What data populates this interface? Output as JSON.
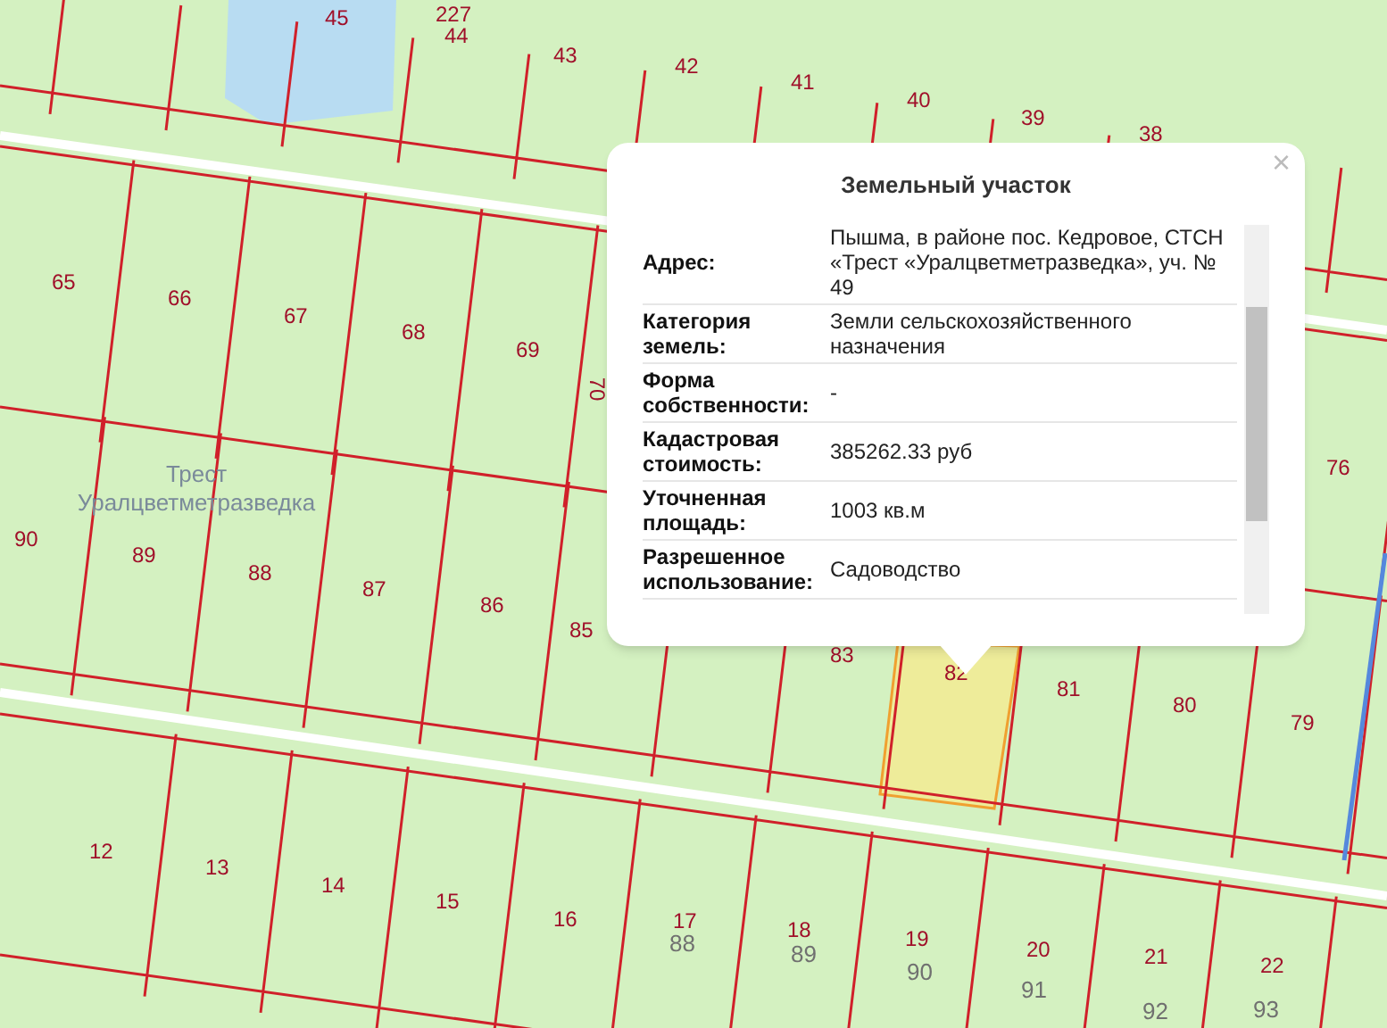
{
  "map": {
    "area_name": "Трест Уралцветметразведка",
    "labels": [
      {
        "text": "227",
        "kind": "parcel"
      },
      {
        "text": "45",
        "kind": "parcel"
      },
      {
        "text": "44",
        "kind": "parcel"
      },
      {
        "text": "43",
        "kind": "parcel"
      },
      {
        "text": "42",
        "kind": "parcel"
      },
      {
        "text": "41",
        "kind": "parcel"
      },
      {
        "text": "40",
        "kind": "parcel"
      },
      {
        "text": "39",
        "kind": "parcel"
      },
      {
        "text": "38",
        "kind": "parcel"
      },
      {
        "text": "65",
        "kind": "parcel"
      },
      {
        "text": "66",
        "kind": "parcel"
      },
      {
        "text": "67",
        "kind": "parcel"
      },
      {
        "text": "68",
        "kind": "parcel"
      },
      {
        "text": "69",
        "kind": "parcel"
      },
      {
        "text": "70",
        "kind": "vertical"
      },
      {
        "text": "76",
        "kind": "parcel"
      },
      {
        "text": "90",
        "kind": "parcel"
      },
      {
        "text": "89",
        "kind": "parcel"
      },
      {
        "text": "88",
        "kind": "parcel"
      },
      {
        "text": "87",
        "kind": "parcel"
      },
      {
        "text": "86",
        "kind": "parcel"
      },
      {
        "text": "85",
        "kind": "parcel"
      },
      {
        "text": "83",
        "kind": "parcel"
      },
      {
        "text": "82",
        "kind": "parcel"
      },
      {
        "text": "81",
        "kind": "parcel"
      },
      {
        "text": "80",
        "kind": "parcel"
      },
      {
        "text": "79",
        "kind": "parcel"
      },
      {
        "text": "12",
        "kind": "parcel"
      },
      {
        "text": "13",
        "kind": "parcel"
      },
      {
        "text": "14",
        "kind": "parcel"
      },
      {
        "text": "15",
        "kind": "parcel"
      },
      {
        "text": "16",
        "kind": "parcel"
      },
      {
        "text": "17",
        "kind": "parcel"
      },
      {
        "text": "88",
        "kind": "old"
      },
      {
        "text": "18",
        "kind": "parcel"
      },
      {
        "text": "89",
        "kind": "old"
      },
      {
        "text": "19",
        "kind": "parcel"
      },
      {
        "text": "90",
        "kind": "old"
      },
      {
        "text": "20",
        "kind": "parcel"
      },
      {
        "text": "91",
        "kind": "old"
      },
      {
        "text": "21",
        "kind": "parcel"
      },
      {
        "text": "92",
        "kind": "old"
      },
      {
        "text": "22",
        "kind": "parcel"
      },
      {
        "text": "93",
        "kind": "old"
      }
    ]
  },
  "popup": {
    "title": "Земельный участок",
    "close": "×",
    "rows": [
      {
        "label": "Адрес:",
        "value": "Пышма, в районе пос. Кедровое, СТСН «Трест «Уралцветметразведка», уч. № 49"
      },
      {
        "label": "Категория земель:",
        "value": "Земли сельскохозяйственного назначения"
      },
      {
        "label": "Форма собственности:",
        "value": "-"
      },
      {
        "label": "Кадастровая стоимость:",
        "value": "385262.33 руб"
      },
      {
        "label": "Уточненная площадь:",
        "value": "1003 кв.м"
      },
      {
        "label": "Разрешенное использование:",
        "value": "Садоводство"
      }
    ]
  }
}
